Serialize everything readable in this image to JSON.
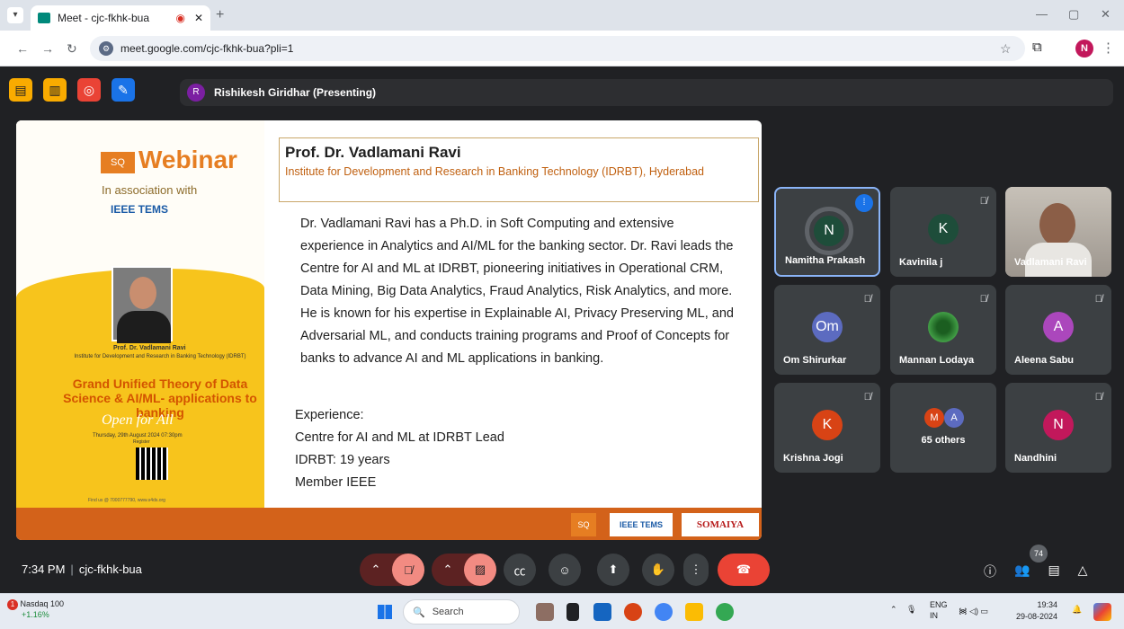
{
  "browser": {
    "tab_title": "Meet - cjc-fkhk-bua",
    "tab_recording_icon": "recording-dot-icon",
    "url": "meet.google.com/cjc-fkhk-bua?pli=1",
    "profile_initial": "N"
  },
  "meet": {
    "presenter_initial": "R",
    "presenter_label": "Rishikesh Giridhar (Presenting)",
    "meeting_time": "7:34 PM",
    "meeting_code": "cjc-fkhk-bua",
    "participant_count": "74"
  },
  "slide": {
    "poster": {
      "logo_text": "SQ",
      "heading": "Webinar",
      "association": "In association with",
      "ieee": "IEEE TEMS",
      "speaker_name": "Prof. Dr. Vadlamani Ravi",
      "speaker_institute": "Institute for Development and Research in Banking Technology (IDRBT)",
      "title": "Grand Unified Theory of Data Science & AI/ML- applications to banking",
      "open_for_all": "Open for All",
      "date": "Thursday, 29th August 2024 07:30pm",
      "register": "Register",
      "find_us": "Find us @ 7000777790, www.s4ds.org"
    },
    "prof_name": "Prof. Dr. Vadlamani Ravi",
    "prof_institute": "Institute for Development and Research in Banking Technology (IDRBT), Hyderabad",
    "bio": "Dr. Vadlamani Ravi has a Ph.D. in Soft Computing and extensive experience in Analytics and AI/ML for the banking sector. Dr. Ravi leads the Centre for AI and ML at IDRBT, pioneering initiatives in Operational CRM, Data Mining, Big Data Analytics, Fraud Analytics, Risk Analytics, and more. He is known for his expertise in Explainable AI, Privacy Preserving ML, and Adversarial ML, and conducts training programs and Proof of Concepts for banks to advance AI and ML applications in banking.",
    "experience_heading": "Experience:",
    "experience_items": [
      "Centre for AI and ML at IDRBT Lead",
      "IDRBT: 19 years",
      "Member IEEE"
    ],
    "footer_logos": [
      "SQ",
      "IEEE TEMS",
      "SOMAIYA"
    ]
  },
  "participants": [
    {
      "name": "Namitha Prakash",
      "initial": "N",
      "color": "#1e4d3a",
      "muted": false,
      "speaking": true
    },
    {
      "name": "Kavinila j",
      "initial": "K",
      "color": "#1e4d3a",
      "muted": true
    },
    {
      "name": "Vadlamani Ravi",
      "video": true,
      "muted": false
    },
    {
      "name": "Om Shirurkar",
      "initial": "Om",
      "color": "#5c6bc0",
      "muted": true
    },
    {
      "name": "Mannan Lodaya",
      "initial": "",
      "color": "#2e7d32",
      "muted": true
    },
    {
      "name": "Aleena Sabu",
      "initial": "A",
      "color": "#ab47bc",
      "muted": true
    },
    {
      "name": "Krishna Jogi",
      "initial": "K",
      "color": "#d84315",
      "muted": true
    },
    {
      "name": "65 others",
      "initials": [
        "M",
        "A"
      ],
      "muted": false
    },
    {
      "name": "Nandhini",
      "initial": "N",
      "color": "#c2185b",
      "muted": true
    }
  ],
  "taskbar": {
    "stock_name": "Nasdaq 100",
    "stock_change": "+1.16%",
    "stock_badge": "1",
    "search_placeholder": "Search",
    "lang_top": "ENG",
    "lang_bottom": "IN",
    "clock_time": "19:34",
    "clock_date": "29-08-2024"
  }
}
